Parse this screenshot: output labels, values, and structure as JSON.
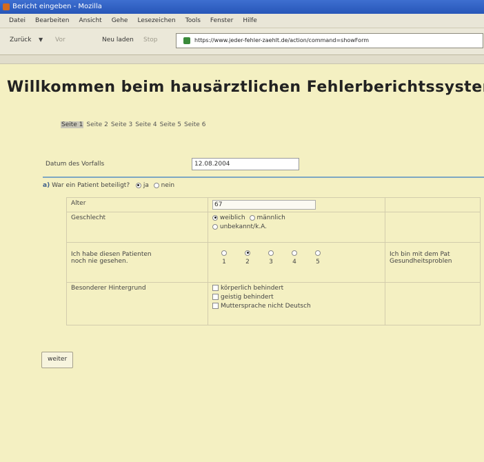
{
  "window": {
    "title": "Bericht eingeben - Mozilla"
  },
  "menu": [
    "Datei",
    "Bearbeiten",
    "Ansicht",
    "Gehe",
    "Lesezeichen",
    "Tools",
    "Fenster",
    "Hilfe"
  ],
  "nav": {
    "back": "Zurück",
    "forward": "Vor",
    "reload": "Neu laden",
    "stop": "Stop",
    "url": "https://www.jeder-fehler-zaehlt.de/action/command=showForm"
  },
  "page": {
    "title": "Willkommen beim hausärztlichen Fehlerberichtssystem",
    "pages": [
      "Seite 1",
      "Seite 2",
      "Seite 3",
      "Seite 4",
      "Seite 5",
      "Seite 6"
    ],
    "current_page_index": 0
  },
  "form": {
    "date_label": "Datum des Vorfalls",
    "date_value": "12.08.2004",
    "question_prefix": "a)",
    "question": "War ein Patient beteiligt?",
    "yes": "ja",
    "no": "nein",
    "patient_involved": "ja",
    "table": {
      "age_label": "Alter",
      "age_value": "67",
      "gender_label": "Geschlecht",
      "gender_options": [
        "weiblich",
        "männlich",
        "unbekannt/k.A."
      ],
      "gender_selected": "weiblich",
      "familiarity_label": "Ich habe diesen Patienten noch nie gesehen.",
      "familiarity_label_line1": "Ich habe diesen Patienten",
      "familiarity_label_line2": "noch nie gesehen.",
      "scale": [
        "1",
        "2",
        "3",
        "4",
        "5"
      ],
      "scale_selected": "2",
      "familiarity_right_line1": "Ich bin mit dem Pat",
      "familiarity_right_line2": "Gesundheitsproblen",
      "background_label": "Besonderer Hintergrund",
      "background_options": [
        "körperlich behindert",
        "geistig behindert",
        "Muttersprache nicht Deutsch"
      ]
    },
    "submit": "weiter"
  }
}
